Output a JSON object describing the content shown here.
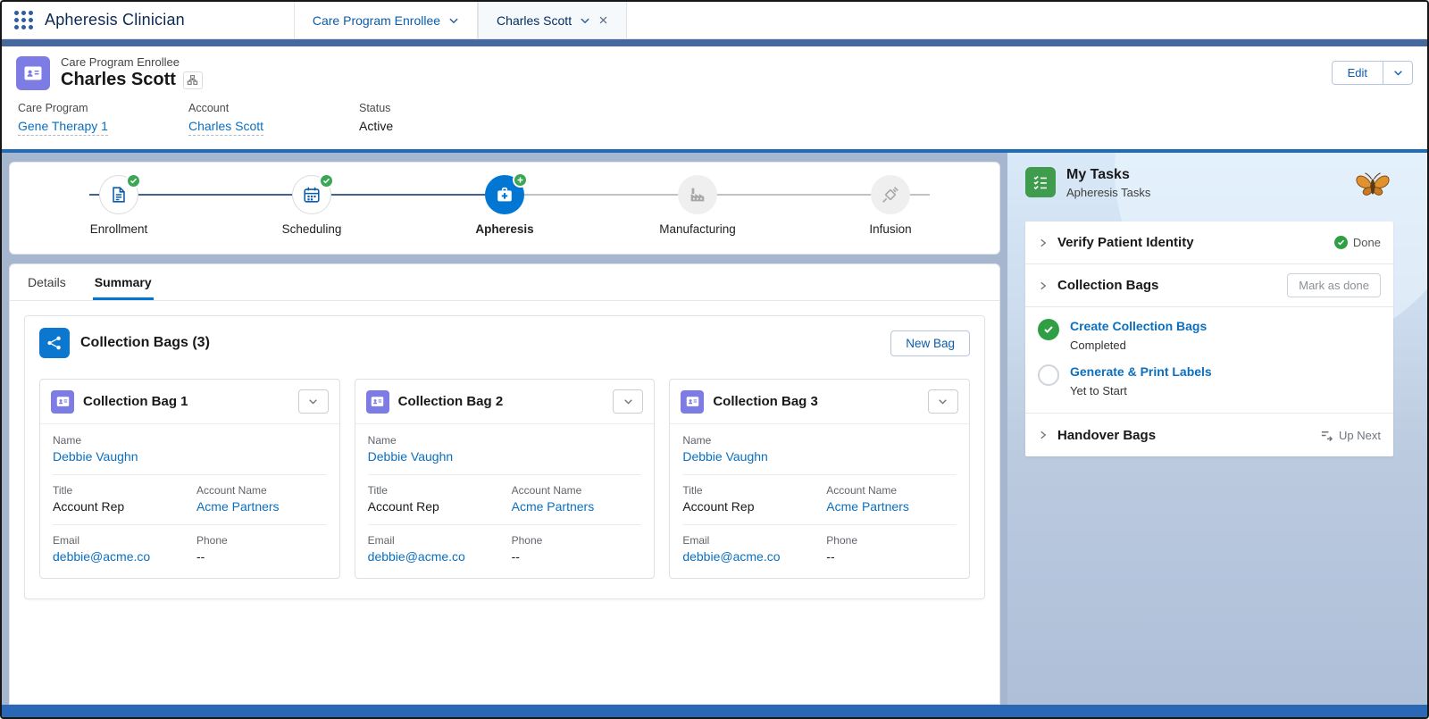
{
  "nav": {
    "app_name": "Apheresis Clinician",
    "tabs": [
      {
        "label": "Care Program Enrollee"
      },
      {
        "label": "Charles Scott"
      }
    ]
  },
  "header": {
    "entity": "Care Program Enrollee",
    "name": "Charles Scott",
    "edit": "Edit",
    "fields": [
      {
        "label": "Care Program",
        "value": "Gene Therapy 1"
      },
      {
        "label": "Account",
        "value": "Charles Scott"
      },
      {
        "label": "Status",
        "value": "Active"
      }
    ]
  },
  "path": {
    "stages": [
      {
        "label": "Enrollment",
        "state": "complete"
      },
      {
        "label": "Scheduling",
        "state": "complete"
      },
      {
        "label": "Apheresis",
        "state": "current"
      },
      {
        "label": "Manufacturing",
        "state": "upcoming"
      },
      {
        "label": "Infusion",
        "state": "upcoming"
      }
    ]
  },
  "content": {
    "tabs": [
      {
        "label": "Details"
      },
      {
        "label": "Summary"
      }
    ],
    "collection_title": "Collection Bags (3)",
    "new_bag": "New Bag",
    "labels": {
      "name": "Name",
      "title": "Title",
      "account": "Account Name",
      "email": "Email",
      "phone": "Phone"
    },
    "bags": [
      {
        "title": "Collection Bag 1",
        "name": "Debbie Vaughn",
        "job": "Account Rep",
        "account": "Acme Partners",
        "email": "debbie@acme.co",
        "phone": "--"
      },
      {
        "title": "Collection Bag 2",
        "name": "Debbie Vaughn",
        "job": "Account Rep",
        "account": "Acme Partners",
        "email": "debbie@acme.co",
        "phone": "--"
      },
      {
        "title": "Collection Bag 3",
        "name": "Debbie Vaughn",
        "job": "Account Rep",
        "account": "Acme Partners",
        "email": "debbie@acme.co",
        "phone": "--"
      }
    ]
  },
  "tasks": {
    "title": "My Tasks",
    "subtitle": "Apheresis Tasks",
    "rows": [
      {
        "label": "Verify Patient Identity",
        "status": "Done"
      },
      {
        "label": "Collection Bags",
        "action": "Mark as done"
      },
      {
        "label": "Handover Bags",
        "status": "Up Next"
      }
    ],
    "subtasks": [
      {
        "label": "Create Collection Bags",
        "status": "Completed"
      },
      {
        "label": "Generate & Print Labels",
        "status": "Yet to Start"
      }
    ]
  },
  "colors": {
    "accent_blue": "#0176d3",
    "link_blue": "#0b6fbe",
    "success_green": "#2f9e44",
    "entity_purple": "#7d7be4",
    "tasks_green": "#3e9c4c"
  }
}
